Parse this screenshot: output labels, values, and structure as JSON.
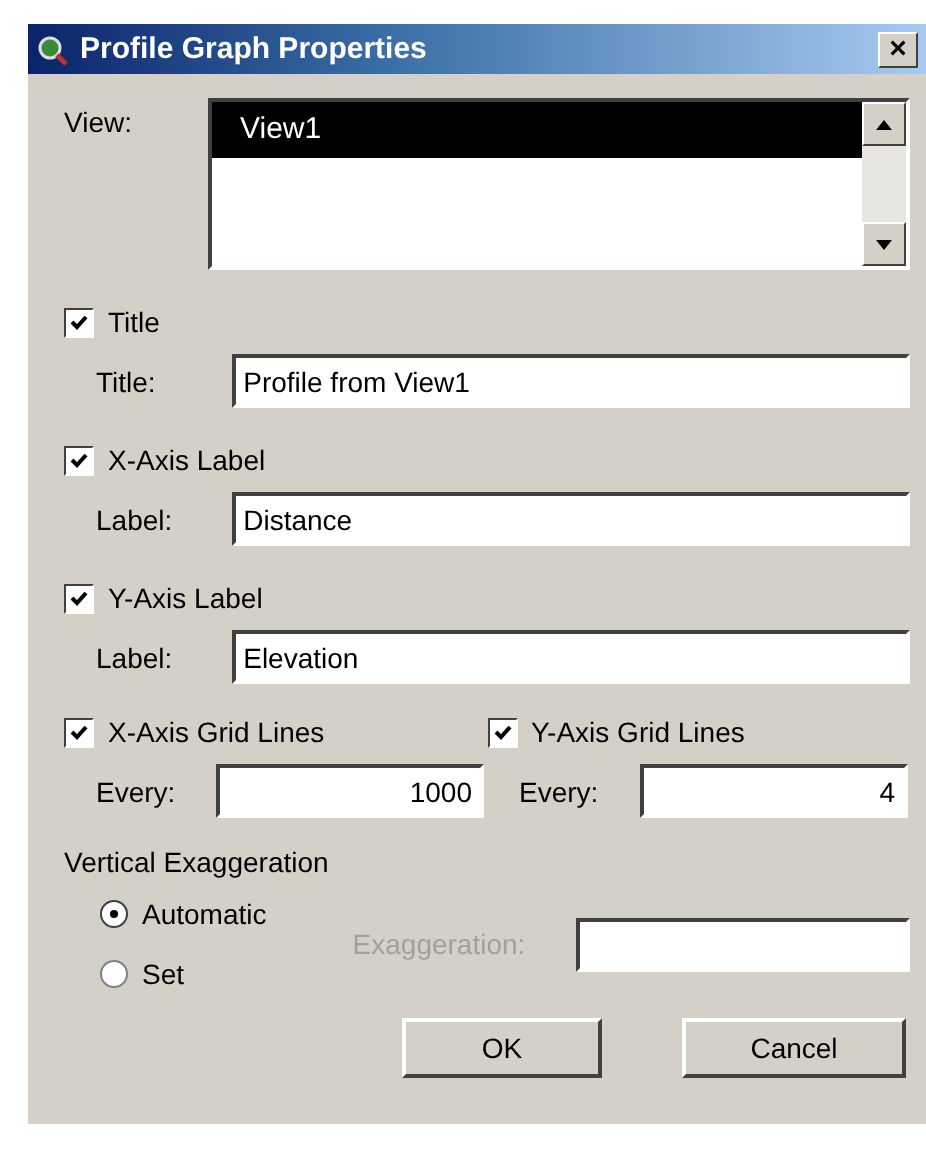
{
  "window": {
    "title": "Profile Graph Properties",
    "close": "×"
  },
  "view": {
    "label": "View:",
    "items": [
      {
        "text": "View1",
        "selected": true
      }
    ]
  },
  "title_section": {
    "checkbox": {
      "label": "Title",
      "checked": true
    },
    "field_label": "Title:",
    "value": "Profile from View1"
  },
  "x_label_section": {
    "checkbox": {
      "label": "X-Axis Label",
      "checked": true
    },
    "field_label": "Label:",
    "value": "Distance"
  },
  "y_label_section": {
    "checkbox": {
      "label": "Y-Axis Label",
      "checked": true
    },
    "field_label": "Label:",
    "value": "Elevation"
  },
  "grid_lines": [
    {
      "checkbox": {
        "label": "X-Axis Grid Lines",
        "checked": true
      },
      "field_label": "Every:",
      "value": "1000"
    },
    {
      "checkbox": {
        "label": "Y-Axis Grid Lines",
        "checked": true
      },
      "field_label": "Every:",
      "value": "4"
    }
  ],
  "exaggeration": {
    "heading": "Vertical Exaggeration",
    "options": [
      {
        "label": "Automatic",
        "selected": true
      },
      {
        "label": "Set",
        "selected": false
      }
    ],
    "field_label": "Exaggeration:",
    "field_disabled": true
  },
  "buttons": [
    "OK",
    "Cancel"
  ]
}
